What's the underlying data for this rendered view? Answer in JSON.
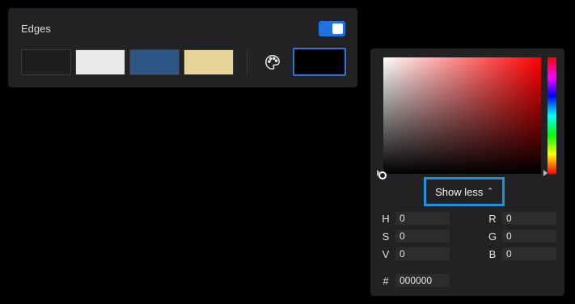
{
  "edges": {
    "title": "Edges",
    "toggle_on": true,
    "swatches": [
      {
        "name": "dark",
        "color": "#1e1e1e"
      },
      {
        "name": "light",
        "color": "#e9e9ea"
      },
      {
        "name": "blue",
        "color": "#2d5586"
      },
      {
        "name": "sand",
        "color": "#e8d59a"
      }
    ],
    "palette_icon": "palette-icon",
    "selected_color": "#000000"
  },
  "picker": {
    "show_less_label": "Show less",
    "chevron": "⌃",
    "hsv": [
      {
        "label": "H",
        "value": "0"
      },
      {
        "label": "S",
        "value": "0"
      },
      {
        "label": "V",
        "value": "0"
      }
    ],
    "rgb": [
      {
        "label": "R",
        "value": "0"
      },
      {
        "label": "G",
        "value": "0"
      },
      {
        "label": "B",
        "value": "0"
      }
    ],
    "hex_label": "#",
    "hex_value": "000000"
  }
}
